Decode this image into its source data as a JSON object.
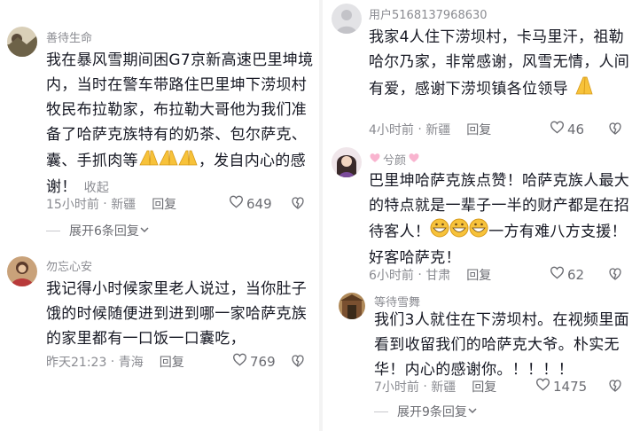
{
  "left": {
    "comments": [
      {
        "username": "善待生命",
        "avatar_icon": "avatar-landscape-icon",
        "text": "我在暴风雪期间困G7京新高速巴里坤境内，当时在警车带路住巴里坤下涝坝村牧民布拉勒家，布拉勒大哥他为我们准备了哈萨克族特有的奶茶、包尔萨克、囊、手抓肉等",
        "text_tail": "，发自内心的感谢！",
        "emojis": "pray-hands-icon x3",
        "collapse_label": "收起",
        "time": "15小时前",
        "location": "新疆",
        "reply_label": "回复",
        "likes": "649",
        "expand_label": "展开6条回复"
      },
      {
        "username": "勿忘心安",
        "avatar_icon": "avatar-person-icon",
        "text": "我记得小时候家里老人说过，当你肚子饿的时候随便进到进到哪一家哈萨克族的家里都有一口饭一口囊吃，",
        "time": "昨天21:23",
        "location": "青海",
        "reply_label": "回复",
        "likes": "769"
      }
    ]
  },
  "right": {
    "comments": [
      {
        "username": "用户5168137968630",
        "avatar_icon": "default-avatar-icon",
        "text": "我家4人住下涝坝村，卡马里汗，祖勒哈尔乃家，非常感谢，风雪无情，人间有爱，感谢下涝坝镇各位领导",
        "emojis": "pray-hands-icon",
        "time": "4小时前",
        "location": "新疆",
        "reply_label": "回复",
        "likes": "46"
      },
      {
        "username": "兮颜",
        "avatar_icon": "avatar-woman-icon",
        "name_decoration": "pink-heart-icon",
        "text_a": "巴里坤哈萨克族点赞！哈萨克族人最大的特点就是一辈子一半的财产都是在招待客人！",
        "text_b": "一方有难八方支援！好客哈萨克！",
        "emojis": "grin-face-icon x3",
        "time": "6小时前",
        "location": "甘肃",
        "reply_label": "回复",
        "likes": "62"
      },
      {
        "username": "等待雪舞",
        "avatar_icon": "avatar-gate-icon",
        "text": "我们3人就住在下涝坝村。在视频里面看到收留我们的哈萨克大爷。朴实无华！内心的感谢你。！！！！",
        "time": "7小时前",
        "location": "新疆",
        "reply_label": "回复",
        "likes": "1475",
        "expand_label": "展开9条回复"
      }
    ]
  },
  "colors": {
    "text": "#161823",
    "muted": "#8a8b91",
    "emoji_yellow": "#f7c23a"
  }
}
